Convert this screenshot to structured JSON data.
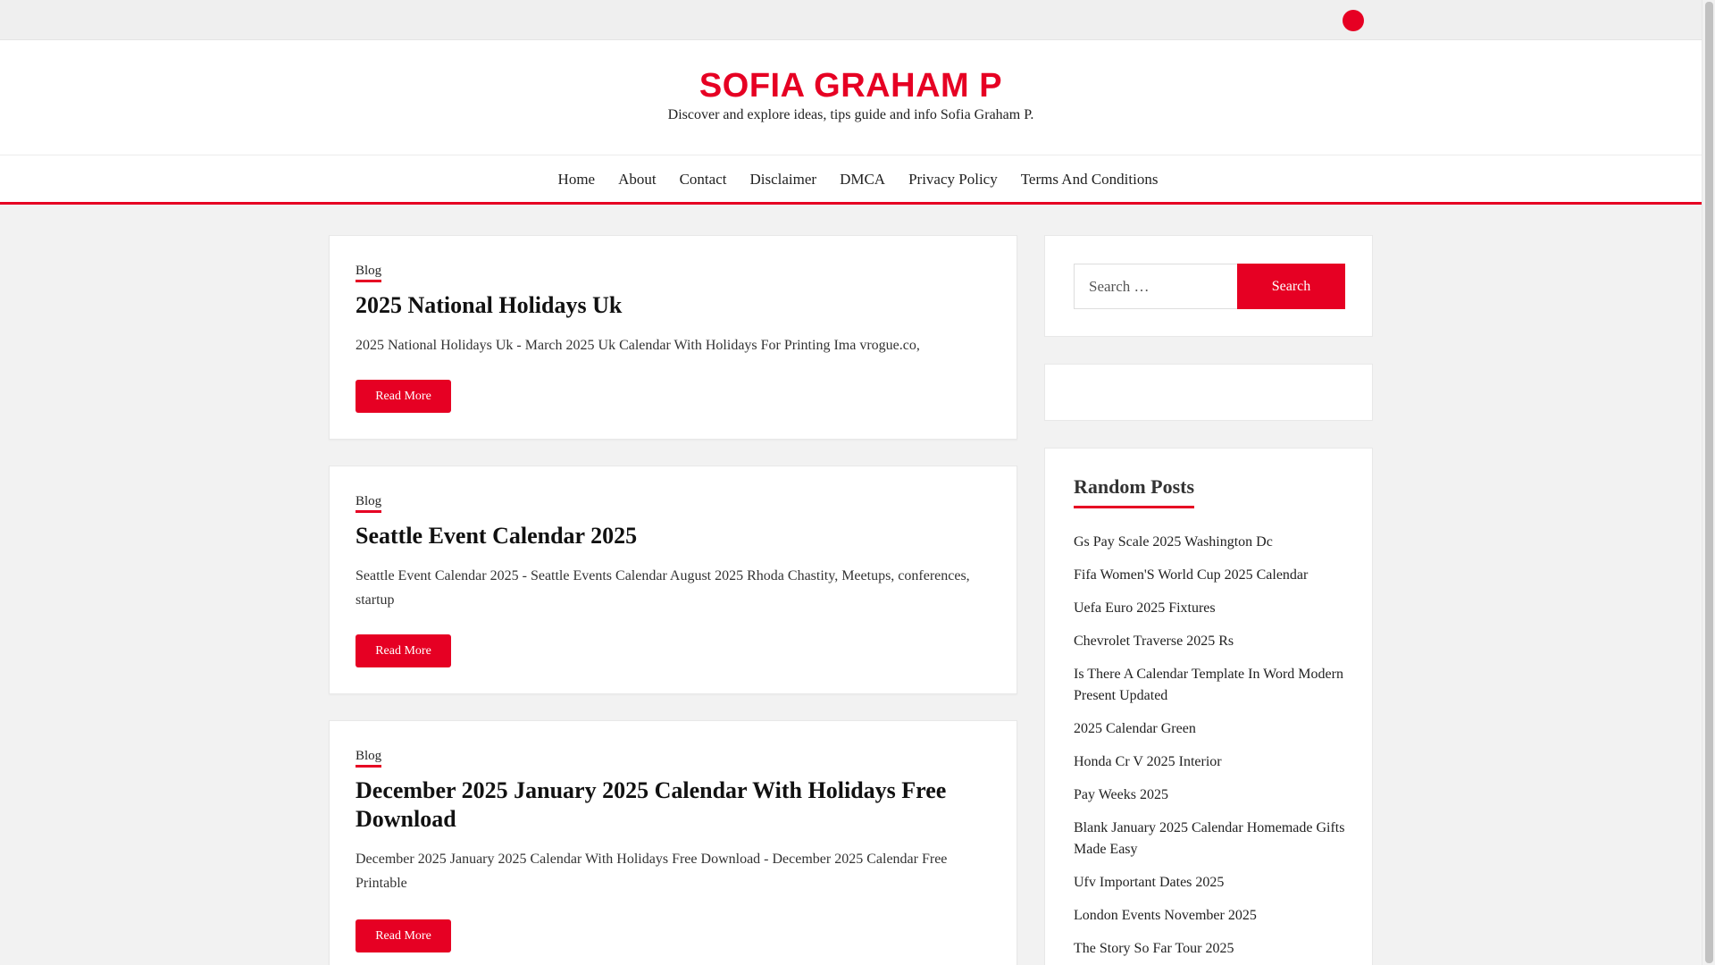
{
  "site": {
    "title": "SOFIA GRAHAM P",
    "description": "Discover and explore ideas, tips guide and info Sofia Graham P."
  },
  "topbar": {
    "search_icon": "search-icon",
    "accent": "#e60023"
  },
  "nav": {
    "items": [
      {
        "label": "Home"
      },
      {
        "label": "About"
      },
      {
        "label": "Contact"
      },
      {
        "label": "Disclaimer"
      },
      {
        "label": "DMCA"
      },
      {
        "label": "Privacy Policy"
      },
      {
        "label": "Terms And Conditions"
      }
    ]
  },
  "posts": [
    {
      "category": "Blog",
      "title": "2025 National Holidays Uk",
      "excerpt": "2025 National Holidays Uk - March 2025 Uk Calendar With Holidays For Printing Ima vrogue.co,",
      "button": "Read More"
    },
    {
      "category": "Blog",
      "title": "Seattle Event Calendar 2025",
      "excerpt": "Seattle Event Calendar 2025 - Seattle Events Calendar August 2025 Rhoda Chastity, Meetups, conferences, startup",
      "button": "Read More"
    },
    {
      "category": "Blog",
      "title": "December 2025 January 2025 Calendar With Holidays Free Download",
      "excerpt": "December 2025 January 2025 Calendar With Holidays Free Download - December 2025 Calendar Free Printable",
      "button": "Read More"
    }
  ],
  "sidebar": {
    "search": {
      "placeholder": "Search …",
      "button": "Search"
    },
    "random_posts": {
      "title": "Random Posts",
      "items": [
        "Gs Pay Scale 2025 Washington Dc",
        "Fifa Women'S World Cup 2025 Calendar",
        "Uefa Euro 2025 Fixtures",
        "Chevrolet Traverse 2025 Rs",
        "Is There A Calendar Template In Word Modern Present Updated",
        "2025 Calendar Green",
        "Honda Cr V 2025 Interior",
        "Pay Weeks 2025",
        "Blank January 2025 Calendar Homemade Gifts Made Easy",
        "Ufv Important Dates 2025",
        "London Events November 2025",
        "The Story So Far Tour 2025"
      ]
    }
  }
}
